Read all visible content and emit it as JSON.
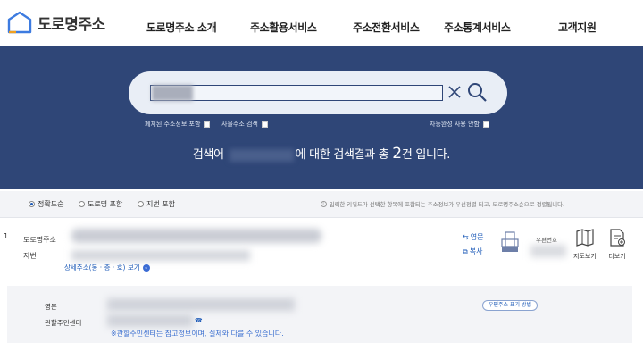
{
  "header": {
    "logo_text": "도로명주소",
    "nav": [
      "도로명주소 소개",
      "주소활용서비스",
      "주소전환서비스",
      "주소통계서비스",
      "고객지원"
    ]
  },
  "search": {
    "input_value": "",
    "options": {
      "abolished_label": "폐지된 주소정보 포함",
      "cadastral_label": "사물주소 검색",
      "autocomplete_label": "자동완성 사용 안함"
    },
    "summary_prefix": "검색어",
    "summary_middle": "에 대한 검색결과 총",
    "summary_count": "2",
    "summary_suffix": "건 입니다."
  },
  "sort": {
    "options": [
      "정확도순",
      "도로명 포함",
      "지번 포함"
    ],
    "selected": "정확도순",
    "note": "입력한 키워드가 선택한 항목에 포함되는 주소정보가 우선정렬 되고, 도로명주소순으로 정렬됩니다."
  },
  "result": {
    "index": "1",
    "road_label": "도로명주소",
    "jibun_label": "지번",
    "detail_link": "상세주소(동 · 층 · 호) 보기",
    "eng_action": "영문",
    "copy_action": "복사",
    "postal_label": "우편번호",
    "map_label": "지도보기",
    "more_label": "더보기"
  },
  "detail": {
    "eng_label": "영문",
    "center_label": "관할주민센터",
    "eng_badge": "우편주소 표기 방법",
    "note": "※관할주민센터는 참고정보이며, 실제와 다를 수 있습니다."
  },
  "colors": {
    "band": "#2f4677",
    "accent": "#1e5bb8"
  }
}
